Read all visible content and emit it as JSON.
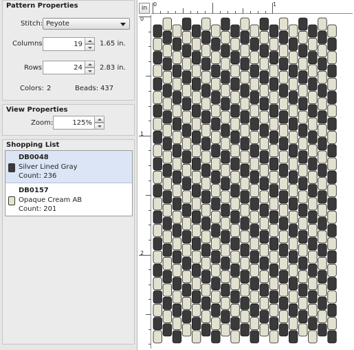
{
  "pattern_properties": {
    "title": "Pattern Properties",
    "stitch_label": "Stitch:",
    "stitch_value": "Peyote",
    "columns_label": "Columns:",
    "columns_value": "19",
    "columns_inches": "1.65 in.",
    "rows_label": "Rows:",
    "rows_value": "24",
    "rows_inches": "2.83 in.",
    "colors_label": "Colors:",
    "colors_value": "2",
    "beads_label": "Beads:",
    "beads_value": "437"
  },
  "view_properties": {
    "title": "View Properties",
    "zoom_label": "Zoom:",
    "zoom_value": "125%"
  },
  "shopping_list": {
    "title": "Shopping List",
    "items": [
      {
        "code": "DB0048",
        "name": "Silver Lined Gray",
        "count": "Count: 236",
        "color": "#3b3b3b",
        "selected": true
      },
      {
        "code": "DB0157",
        "name": "Opaque Cream AB",
        "count": "Count: 201",
        "color": "#e6e4cc",
        "selected": false
      }
    ]
  },
  "canvas": {
    "unit_button": "in",
    "ruler_h_labels": [
      "0",
      "1"
    ],
    "ruler_v_labels": [
      "0",
      "1",
      "2"
    ],
    "bead_colors": {
      "dark": "#3a3a3a",
      "light": "#e2e1cf"
    }
  }
}
